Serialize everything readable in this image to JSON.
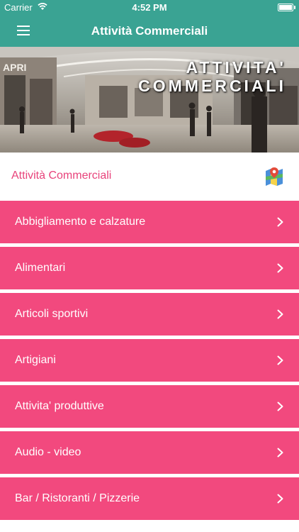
{
  "status_bar": {
    "carrier": "Carrier",
    "time": "4:52 PM",
    "battery_level": 1.0
  },
  "nav": {
    "title": "Attività Commerciali",
    "menu_icon": "hamburger-menu-icon",
    "color": "#3aa393"
  },
  "banner": {
    "line1": "ATTIVITA'",
    "line2": "COMMERCIALI"
  },
  "section": {
    "label": "Attività Commerciali",
    "map_icon": "map-icon",
    "label_color": "#e8437b"
  },
  "categories": {
    "item_color": "#f2497e",
    "items": [
      {
        "label": "Abbigliamento e calzature"
      },
      {
        "label": "Alimentari"
      },
      {
        "label": "Articoli sportivi"
      },
      {
        "label": "Artigiani"
      },
      {
        "label": "Attivita' produttive"
      },
      {
        "label": "Audio - video"
      },
      {
        "label": "Bar / Ristoranti / Pizzerie"
      }
    ]
  }
}
